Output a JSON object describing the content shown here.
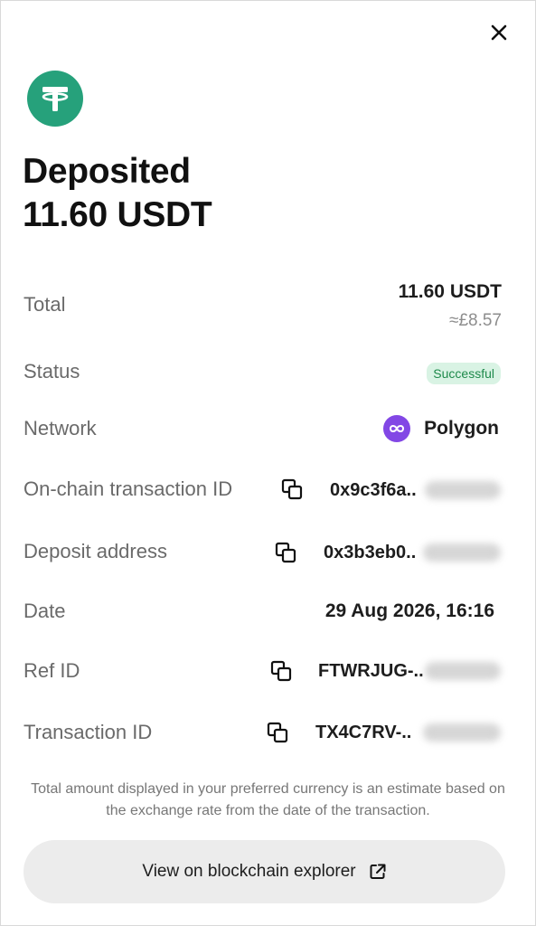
{
  "colors": {
    "tether_green": "#26A17B",
    "polygon_purple": "#8247E5",
    "success_bg": "#D9F3E4",
    "success_text": "#1E8A4B"
  },
  "header": {
    "close_icon": "close-icon",
    "asset_icon": "tether-logo"
  },
  "title": {
    "line1": "Deposited",
    "line2": "11.60 USDT"
  },
  "details": {
    "total": {
      "label": "Total",
      "value": "11.60 USDT",
      "fiat": "≈£8.57"
    },
    "status": {
      "label": "Status",
      "value": "Successful"
    },
    "network": {
      "label": "Network",
      "value": "Polygon",
      "icon": "polygon-icon"
    },
    "onchain_tx": {
      "label": "On-chain transaction ID",
      "value": "0x9c3f6a..",
      "icon": "copy-icon"
    },
    "deposit_address": {
      "label": "Deposit address",
      "value": "0x3b3eb0..",
      "icon": "copy-icon"
    },
    "date": {
      "label": "Date",
      "value": "29 Aug 2026, 16:16"
    },
    "ref_id": {
      "label": "Ref ID",
      "value": "FTWRJUG-..",
      "icon": "copy-icon"
    },
    "transaction_id": {
      "label": "Transaction ID",
      "value": "TX4C7RV-..",
      "icon": "copy-icon"
    }
  },
  "footer": {
    "note": "Total amount displayed in your preferred currency is an estimate based on the exchange rate from the date of the transaction.",
    "button_label": "View on blockchain explorer",
    "button_icon": "external-link-icon"
  }
}
